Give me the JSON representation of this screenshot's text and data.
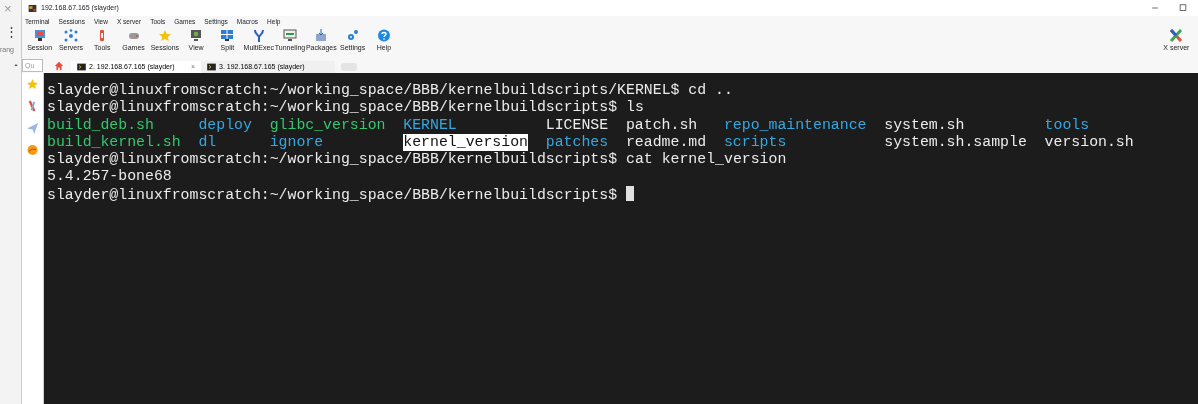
{
  "browser_strip": {
    "close": "×",
    "menu": "⋮",
    "cut_text": "rang"
  },
  "window": {
    "title": "192.168.67.165 (slayder)"
  },
  "menu": [
    "Terminal",
    "Sessions",
    "View",
    "X server",
    "Tools",
    "Games",
    "Settings",
    "Macros",
    "Help"
  ],
  "toolbar": [
    "Session",
    "Servers",
    "Tools",
    "Games",
    "Sessions",
    "View",
    "Split",
    "MultiExec",
    "Tunneling",
    "Packages",
    "Settings",
    "Help"
  ],
  "xserver": {
    "label": "X server"
  },
  "sidebar": {
    "search": {
      "value": "Qu"
    }
  },
  "tabs": [
    {
      "label": "2. 192.168.67.165 (slayder)",
      "selected": true,
      "close": "×"
    },
    {
      "label": "3. 192.168.67.165 (slayder)",
      "selected": false
    }
  ],
  "terminal": {
    "lines": [
      {
        "kind": "prompt",
        "prompt": "slayder@linuxfromscratch:~/working_space/BBB/kernelbuildscripts/KERNEL$",
        "command": "cd .."
      },
      {
        "kind": "prompt",
        "prompt": "slayder@linuxfromscratch:~/working_space/BBB/kernelbuildscripts$",
        "command": "ls"
      },
      {
        "kind": "listing",
        "entries": [
          {
            "text": "build_deb.sh",
            "kind": "executable",
            "highlighted": false
          },
          {
            "text": "deploy",
            "kind": "directory",
            "highlighted": false
          },
          {
            "text": "glibc_version",
            "kind": "executable",
            "highlighted": false
          },
          {
            "text": "KERNEL",
            "kind": "directory",
            "highlighted": false
          },
          {
            "text": "LICENSE",
            "kind": "file",
            "highlighted": false
          },
          {
            "text": "patch.sh",
            "kind": "file",
            "highlighted": false
          },
          {
            "text": "repo_maintenance",
            "kind": "directory",
            "highlighted": false
          },
          {
            "text": "system.sh",
            "kind": "file",
            "highlighted": false
          },
          {
            "text": "tools",
            "kind": "directory",
            "highlighted": false
          }
        ]
      },
      {
        "kind": "listing",
        "entries": [
          {
            "text": "build_kernel.sh",
            "kind": "executable",
            "highlighted": false
          },
          {
            "text": "dl",
            "kind": "directory",
            "highlighted": false
          },
          {
            "text": "ignore",
            "kind": "directory",
            "highlighted": false
          },
          {
            "text": "kernel_version",
            "kind": "file",
            "highlighted": true
          },
          {
            "text": "patches",
            "kind": "directory",
            "highlighted": false
          },
          {
            "text": "readme.md",
            "kind": "file",
            "highlighted": false
          },
          {
            "text": "scripts",
            "kind": "directory",
            "highlighted": false
          },
          {
            "text": "system.sh.sample",
            "kind": "file",
            "highlighted": false
          },
          {
            "text": "version.sh",
            "kind": "file",
            "highlighted": false
          }
        ]
      },
      {
        "kind": "prompt",
        "prompt": "slayder@linuxfromscratch:~/working_space/BBB/kernelbuildscripts$",
        "command": "cat kernel_version"
      },
      {
        "kind": "output",
        "text": "5.4.257-bone68"
      },
      {
        "kind": "prompt",
        "prompt": "slayder@linuxfromscratch:~/working_space/BBB/kernelbuildscripts$",
        "cursor": true
      }
    ]
  }
}
